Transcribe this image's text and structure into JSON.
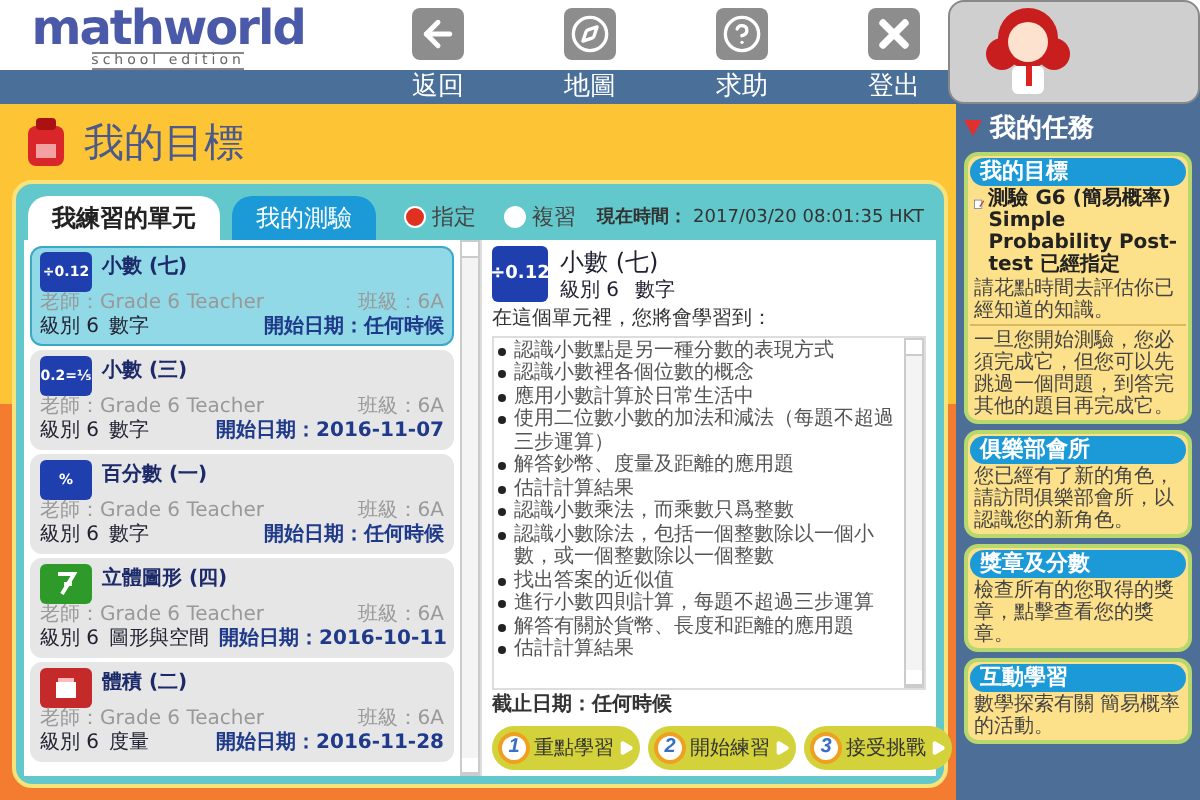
{
  "logo": {
    "name": "mathworld",
    "edition": "school edition"
  },
  "nav": [
    {
      "kind": "back",
      "label": "返回"
    },
    {
      "kind": "map",
      "label": "地圖"
    },
    {
      "kind": "help",
      "label": "求助"
    },
    {
      "kind": "logout",
      "label": "登出"
    }
  ],
  "page_title": "我的目標",
  "tabs": [
    {
      "label": "我練習的單元",
      "selected": true
    },
    {
      "label": "我的測驗",
      "selected": false
    }
  ],
  "filters": [
    {
      "label": "指定",
      "selected": true
    },
    {
      "label": "複習",
      "selected": false
    }
  ],
  "clock": {
    "label": "現在時間：",
    "value": "2017/03/20 08:01:35 HKT"
  },
  "units": [
    {
      "icon": {
        "kind": "text",
        "text": "÷0.12"
      },
      "color": "#1f3fae",
      "title": "小數 (七)",
      "teacher": "老師：Grade 6 Teacher",
      "class": "班級：6A",
      "grade": "級別 6",
      "topic": "數字",
      "date": "開始日期：任何時候",
      "selected": true
    },
    {
      "icon": {
        "kind": "text",
        "text": "0.2=⅕"
      },
      "color": "#1f3fae",
      "title": "小數 (三)",
      "teacher": "老師：Grade 6 Teacher",
      "class": "班級：6A",
      "grade": "級別 6",
      "topic": "數字",
      "date": "開始日期：2016-11-07",
      "selected": false
    },
    {
      "icon": {
        "kind": "text",
        "text": "%"
      },
      "color": "#1f3fae",
      "title": "百分數 (一)",
      "teacher": "老師：Grade 6 Teacher",
      "class": "班級：6A",
      "grade": "級別 6",
      "topic": "數字",
      "date": "開始日期：任何時候",
      "selected": false
    },
    {
      "icon": {
        "kind": "shape"
      },
      "color": "#2e9a2a",
      "title": "立體圖形 (四)",
      "teacher": "老師：Grade 6 Teacher",
      "class": "班級：6A",
      "grade": "級別 6",
      "topic": "圖形與空間",
      "date": "開始日期：2016-10-11",
      "selected": false
    },
    {
      "icon": {
        "kind": "box"
      },
      "color": "#c42a2a",
      "title": "體積 (二)",
      "teacher": "老師：Grade 6 Teacher",
      "class": "班級：6A",
      "grade": "級別 6",
      "topic": "度量",
      "date": "開始日期：2016-11-28",
      "selected": false
    }
  ],
  "detail": {
    "icon_text": "÷0.12",
    "title": "小數 (七)",
    "grade": "級別 6",
    "topic": "數字",
    "intro": "在這個單元裡，您將會學習到：",
    "points": [
      "認識小數點是另一種分數的表現方式",
      "認識小數裡各個位數的概念",
      "應用小數計算於日常生活中",
      "使用二位數小數的加法和減法（每題不超過三步運算）",
      "解答鈔幣、度量及距離的應用題",
      "估計計算結果",
      "認識小數乘法，而乘數只爲整數",
      "認識小數除法，包括一個整數除以一個小數，或一個整數除以一個整數",
      "找出答案的近似值",
      "進行小數四則計算，每題不超過三步運算",
      "解答有關於貨幣、長度和距離的應用題",
      "估計計算結果"
    ],
    "deadline": "截止日期：任何時候",
    "actions": [
      {
        "number": "1",
        "label": "重點學習"
      },
      {
        "number": "2",
        "label": "開始練習"
      },
      {
        "number": "3",
        "label": "接受挑戰"
      }
    ]
  },
  "tasks": {
    "title": "我的任務",
    "cards": [
      {
        "title": "我的目標",
        "test": "測驗 G6 (簡易概率) Simple Probability Post-test 已經指定",
        "text": "請花點時間去評估你已經知道的知識。",
        "note": "一旦您開始測驗，您必須完成它，但您可以先跳過一個問題，到答完其他的題目再完成它。"
      },
      {
        "title": "俱樂部會所",
        "text": "您已經有了新的角色，請訪問俱樂部會所，以認識您的新角色。"
      },
      {
        "title": "獎章及分數",
        "text": "檢查所有的您取得的獎章，點擊查看您的獎章。"
      },
      {
        "title": "互動學習",
        "text": "數學探索有關 簡易概率的活動。"
      }
    ]
  }
}
